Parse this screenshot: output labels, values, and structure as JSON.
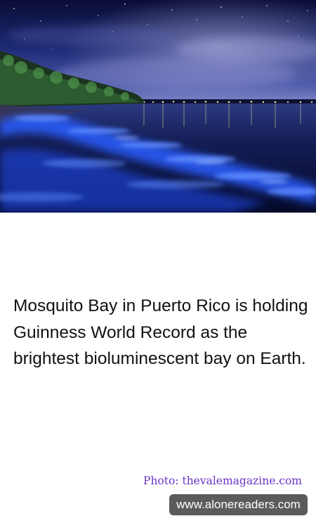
{
  "photo": {
    "subject": "bioluminescent-bay-night-photo"
  },
  "caption": {
    "text": "Mosquito Bay in Puerto Rico is holding Guinness World Record as the brightest bioluminescent bay on Earth."
  },
  "credit": {
    "text": "Photo: thevalemagazine.com"
  },
  "watermark": {
    "text": "www.alonereaders.com"
  },
  "colors": {
    "credit": "#6a35c7",
    "watermark_bg": "#5b5b5b",
    "glow": "#2a5cff"
  }
}
